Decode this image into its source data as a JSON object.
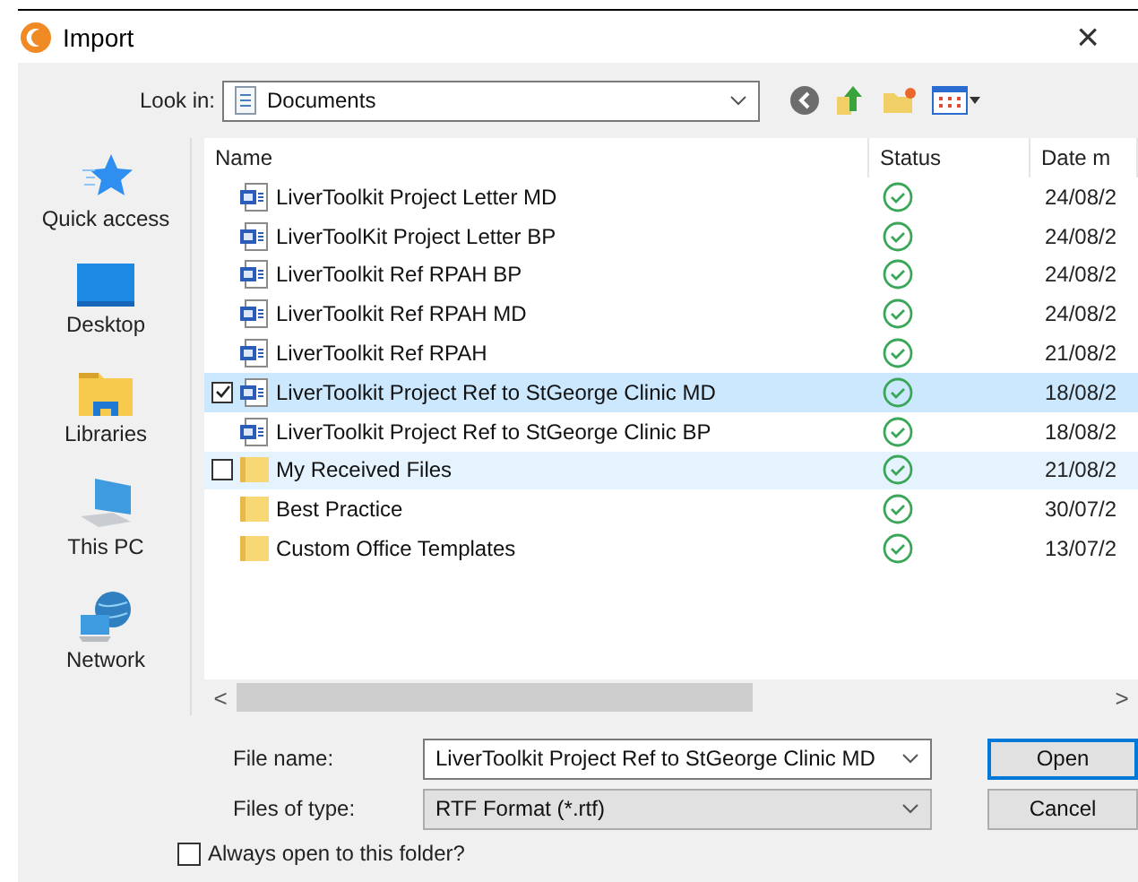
{
  "window": {
    "title": "Import",
    "close": "×"
  },
  "look_in": {
    "label": "Look in:",
    "value": "Documents"
  },
  "places": [
    {
      "label": "Quick access",
      "kind": "star"
    },
    {
      "label": "Desktop",
      "kind": "desktop"
    },
    {
      "label": "Libraries",
      "kind": "library"
    },
    {
      "label": "This PC",
      "kind": "pc"
    },
    {
      "label": "Network",
      "kind": "network"
    }
  ],
  "table": {
    "columns": [
      "Name",
      "Status",
      "Date m"
    ],
    "rows": [
      {
        "name": "LiverToolkit Project Letter MD",
        "kind": "document",
        "date": "24/08/2",
        "selected": false,
        "hovered": false
      },
      {
        "name": "LiverToolKit Project Letter BP",
        "kind": "document",
        "date": "24/08/2",
        "selected": false,
        "hovered": false
      },
      {
        "name": "LiverToolkit Ref RPAH BP",
        "kind": "document",
        "date": "24/08/2",
        "selected": false,
        "hovered": false
      },
      {
        "name": "LiverToolkit Ref RPAH MD",
        "kind": "document",
        "date": "24/08/2",
        "selected": false,
        "hovered": false
      },
      {
        "name": "LiverToolkit Ref RPAH",
        "kind": "document",
        "date": "21/08/2",
        "selected": false,
        "hovered": false
      },
      {
        "name": "LiverToolkit Project Ref to StGeorge Clinic MD",
        "kind": "document",
        "date": "18/08/2",
        "selected": true,
        "hovered": false
      },
      {
        "name": "LiverToolkit Project Ref to StGeorge Clinic BP",
        "kind": "document",
        "date": "18/08/2",
        "selected": false,
        "hovered": false
      },
      {
        "name": "My Received Files",
        "kind": "folder",
        "date": "21/08/2",
        "selected": false,
        "hovered": true
      },
      {
        "name": "Best Practice",
        "kind": "folder",
        "date": "30/07/2",
        "selected": false,
        "hovered": false
      },
      {
        "name": "Custom Office Templates",
        "kind": "folder",
        "date": "13/07/2",
        "selected": false,
        "hovered": false
      }
    ]
  },
  "scroll": {
    "left": "<",
    "right": ">"
  },
  "file_name": {
    "label": "File name:",
    "value": "LiverToolkit Project Ref to StGeorge Clinic MD"
  },
  "file_type": {
    "label": "Files of type:",
    "value": "RTF Format (*.rtf)"
  },
  "buttons": [
    "Open",
    "Cancel"
  ],
  "always_open": {
    "label": "Always open to this folder?",
    "checked": false
  }
}
